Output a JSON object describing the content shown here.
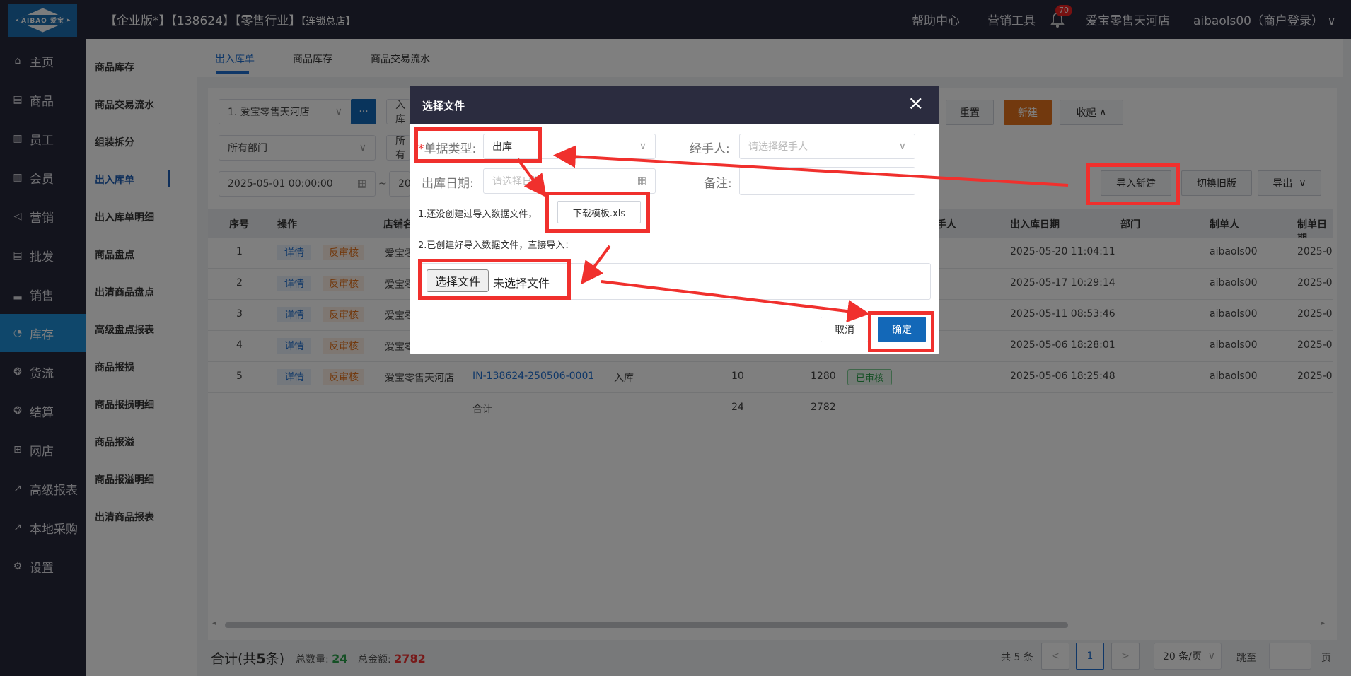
{
  "header": {
    "logo_text": "AIBAO 爱宝",
    "enterprise": "【企业版*】【138624】【零售行业】",
    "chain": "【连锁总店】",
    "help": "帮助中心",
    "marketing": "营销工具",
    "notif_count": "70",
    "store": "爱宝零售天河店",
    "user": "aibaols00（商户登录）"
  },
  "sidebar": [
    {
      "label": "主页",
      "icon": "home-icon",
      "glyph": "⌂"
    },
    {
      "label": "商品",
      "icon": "goods-icon",
      "glyph": "▤"
    },
    {
      "label": "员工",
      "icon": "staff-icon",
      "glyph": "▥"
    },
    {
      "label": "会员",
      "icon": "member-icon",
      "glyph": "▥"
    },
    {
      "label": "营销",
      "icon": "megaphone-icon",
      "glyph": "◁"
    },
    {
      "label": "批发",
      "icon": "wholesale-icon",
      "glyph": "▤"
    },
    {
      "label": "销售",
      "icon": "sales-chart-icon",
      "glyph": "▂"
    },
    {
      "label": "库存",
      "icon": "inventory-pie-icon",
      "glyph": "◔"
    },
    {
      "label": "货流",
      "icon": "flow-icon",
      "glyph": "❂"
    },
    {
      "label": "结算",
      "icon": "settle-icon",
      "glyph": "❂"
    },
    {
      "label": "网店",
      "icon": "gift-icon",
      "glyph": "⊞"
    },
    {
      "label": "高级报表",
      "icon": "report-icon",
      "glyph": "↗"
    },
    {
      "label": "本地采购",
      "icon": "purchase-icon",
      "glyph": "↗"
    },
    {
      "label": "设置",
      "icon": "gear-icon",
      "glyph": "⚙"
    }
  ],
  "submenu": [
    "商品库存",
    "商品交易流水",
    "组装拆分",
    "出入库单",
    "出入库单明细",
    "商品盘点",
    "出清商品盘点",
    "高级盘点报表",
    "商品报损",
    "商品报损明细",
    "商品报溢",
    "商品报溢明细",
    "出清商品报表"
  ],
  "tabs": [
    "出入库单",
    "商品库存",
    "商品交易流水"
  ],
  "filters": {
    "store": "1. 爱宝零售天河店",
    "store_btn": "···",
    "type_partial": "入库",
    "dept": "所有部门",
    "dept2_partial": "所有",
    "date_from": "2025-05-01 00:00:00",
    "tilde": "~",
    "date_to_partial": "20"
  },
  "buttons": {
    "reset": "重置",
    "create": "新建",
    "collapse": "收起",
    "import": "导入新建",
    "switch": "切换旧版",
    "export": "导出"
  },
  "table": {
    "headers": {
      "seq": "序号",
      "op": "操作",
      "store": "店铺名",
      "person": "手人",
      "date": "出入库日期",
      "dept": "部门",
      "maker": "制单人",
      "made": "制单日期"
    },
    "rows": [
      {
        "seq": "1",
        "detail": "详情",
        "reverse": "反审核",
        "store": "爱宝零",
        "date": "2025-05-20 11:04:11",
        "maker": "aibaols00",
        "made": "2025-0"
      },
      {
        "seq": "2",
        "detail": "详情",
        "reverse": "反审核",
        "store": "爱宝零",
        "date": "2025-05-17 10:29:14",
        "maker": "aibaols00",
        "made": "2025-0"
      },
      {
        "seq": "3",
        "detail": "详情",
        "reverse": "反审核",
        "store": "爱宝零",
        "date": "2025-05-11 08:53:46",
        "maker": "aibaols00",
        "made": "2025-0"
      },
      {
        "seq": "4",
        "detail": "详情",
        "reverse": "反审核",
        "store": "爱宝零",
        "date": "2025-05-06 18:28:01",
        "maker": "aibaols00",
        "made": "2025-0"
      },
      {
        "seq": "5",
        "detail": "详情",
        "reverse": "反审核",
        "store": "爱宝零售天河店",
        "no": "IN-138624-250506-0001",
        "kind": "入库",
        "qty": "10",
        "amt": "1280",
        "status": "已审核",
        "date": "2025-05-06 18:25:48",
        "maker": "aibaols00",
        "made": "2025-0"
      }
    ],
    "total": {
      "label": "合计",
      "qty": "24",
      "amt": "2782"
    }
  },
  "footer": {
    "sum_prefix": "合计(共",
    "sum_count": "5",
    "sum_suffix": "条)",
    "qty_label": "总数量:",
    "qty": "24",
    "amt_label": "总金额:",
    "amt": "2782",
    "total": "共 5 条",
    "prev": "<",
    "page": "1",
    "next": ">",
    "page_size": "20 条/页",
    "goto": "跳至",
    "page_unit": "页"
  },
  "modal": {
    "title": "选择文件",
    "close": "×",
    "required": "*",
    "type_label": "单据类型:",
    "type_value": "出库",
    "handler_label": "经手人:",
    "handler_ph": "请选择经手人",
    "date_label": "出库日期:",
    "date_ph": "请选择日期",
    "note_label": "备注:",
    "step1": "1.还没创建过导入数据文件，",
    "download": "下载模板.xls",
    "step2": "2.已创建好导入数据文件，直接导入：",
    "choose": "选择文件",
    "no_file": "未选择文件",
    "cancel": "取消",
    "ok": "确定"
  },
  "colors": {
    "dark": "#27283a",
    "accent": "#1f8fd6",
    "primary": "#1368b8",
    "orange": "#e4731c",
    "highlight": "#f0302d"
  }
}
